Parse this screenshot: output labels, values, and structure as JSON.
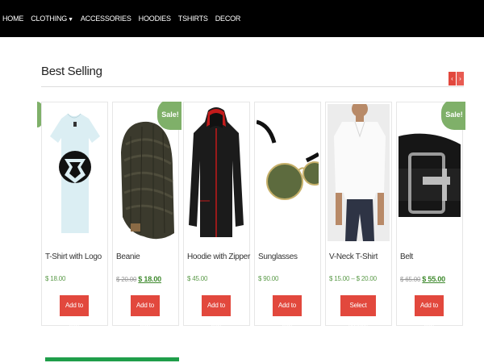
{
  "nav": {
    "items": [
      "HOME",
      "CLOTHING",
      "ACCESSORIES",
      "HOODIES",
      "TSHIRTS",
      "DECOR"
    ]
  },
  "section": {
    "title": "Best Selling",
    "prev": "‹",
    "next": "›"
  },
  "sale_badge": "Sale!",
  "products": [
    {
      "name": "T-Shirt with Logo",
      "price": "$ 18.00",
      "button": "Add to cart"
    },
    {
      "name": "Beanie",
      "old_price": "$ 20.00",
      "price": "$ 18.00",
      "button": "Add to cart",
      "on_sale": true
    },
    {
      "name": "Hoodie with Zipper",
      "price": "$ 45.00",
      "button": "Add to cart"
    },
    {
      "name": "Sunglasses",
      "price": "$ 90.00",
      "button": "Add to cart"
    },
    {
      "name": "V-Neck T-Shirt",
      "price": "$ 15.00 – $ 20.00",
      "button": "Select options"
    },
    {
      "name": "Belt",
      "old_price": "$ 65.00",
      "price": "$ 55.00",
      "button": "Add to cart",
      "on_sale": true
    }
  ],
  "colors": {
    "accent": "#e2483d",
    "sale": "#7fb069",
    "price": "#3f8a2e",
    "header": "#000000"
  }
}
